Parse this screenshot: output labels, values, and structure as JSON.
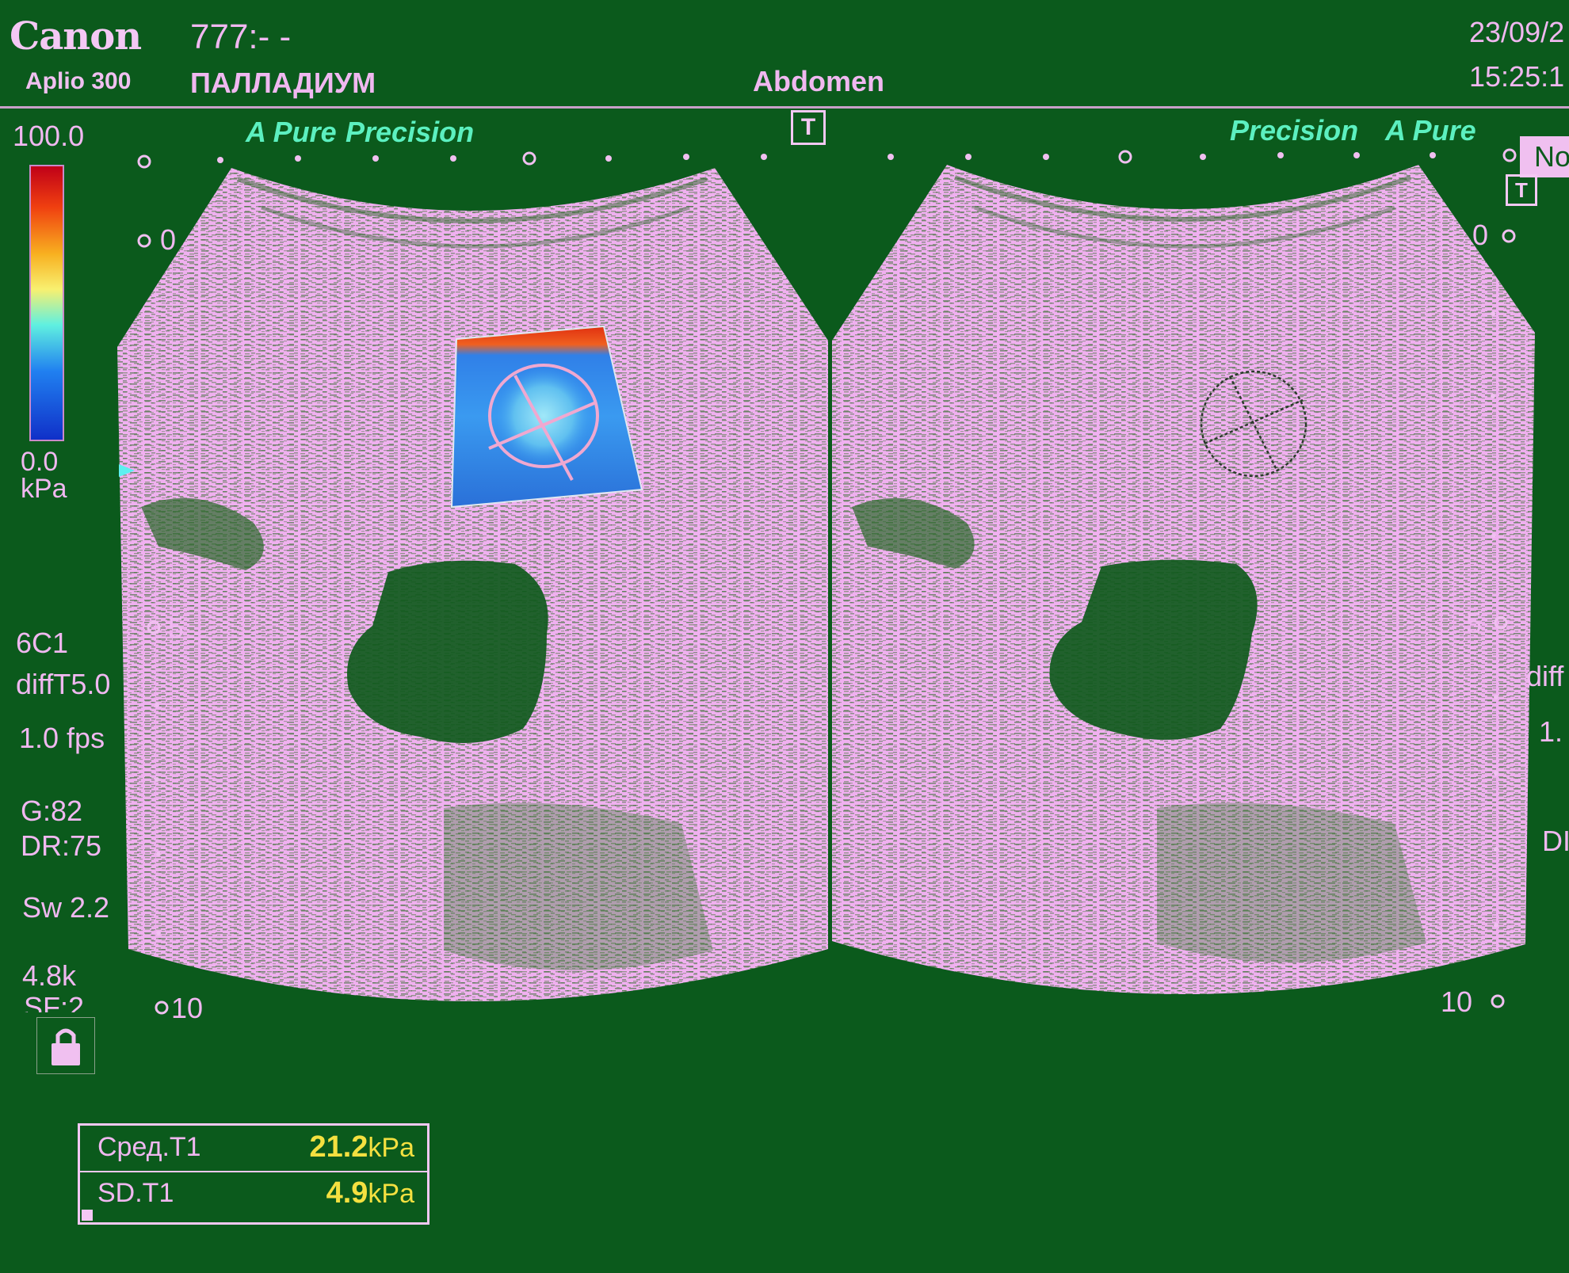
{
  "header": {
    "brand": "Canon",
    "model": "Aplio 300",
    "patient_id": "777:- -",
    "institution": "ПАЛЛАДИУМ",
    "preset": "Abdomen",
    "date": "23/09/2",
    "time": "15:25:1",
    "t_marker": "T",
    "corner_label": "No"
  },
  "left_panel": {
    "mode_left": "A Pure",
    "mode_right": "Precision",
    "depth_marks": [
      "0",
      "5",
      "10"
    ]
  },
  "right_panel": {
    "mode_left": "Precision",
    "mode_right": "A Pure",
    "t_marker": "T",
    "depth_marks": [
      "0",
      "5",
      "10"
    ],
    "edge_texts": [
      "diff",
      "1.",
      "DI"
    ]
  },
  "color_scale": {
    "max": "100.0",
    "min": "0.0",
    "unit": "kPa"
  },
  "settings": {
    "probe": "6C1",
    "harmonic": "diffT5.0",
    "frame_rate": "1.0 fps",
    "gain": "G:82",
    "dynamic_range": "DR:75",
    "sweep": "Sw 2.2",
    "prf": "4.8k",
    "sf": "SF:2"
  },
  "measurements": [
    {
      "label": "Сред.T1",
      "value": "21.2",
      "unit": "kPa"
    },
    {
      "label": "SD.T1",
      "value": "4.9",
      "unit": "kPa"
    }
  ],
  "colors": {
    "background": "#0b5a1c",
    "tissue": "#f0b0f0",
    "text": "#f0b8f0",
    "accent": "#5cf0c0",
    "value": "#f4e040"
  },
  "icons": [
    "lock-icon",
    "roi-circle-icon"
  ]
}
